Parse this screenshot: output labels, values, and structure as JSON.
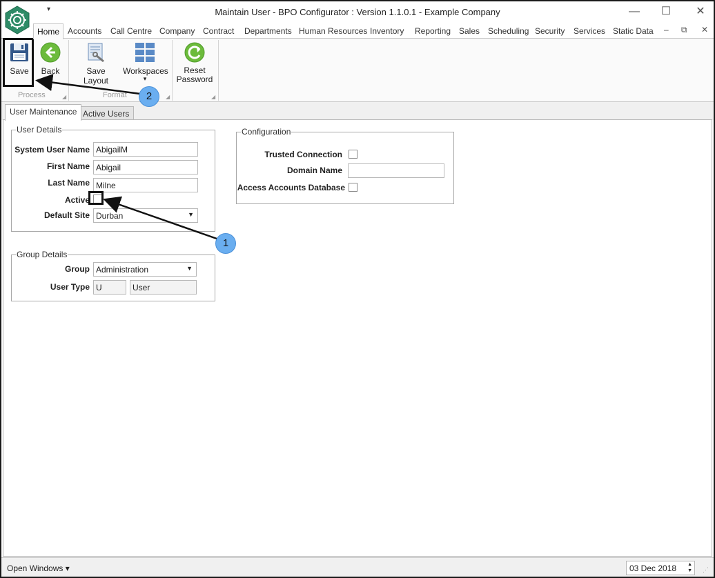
{
  "window": {
    "title": "Maintain User - BPO Configurator : Version 1.1.0.1 - Example Company",
    "controls": {
      "minimize": "—",
      "maximize": "☐",
      "close": "✕"
    },
    "mdi_controls": {
      "minimize": "–",
      "restore": "⧉",
      "close": "✕"
    },
    "qat": "▾"
  },
  "ribbon_tabs": [
    "Home",
    "Accounts",
    "Call Centre",
    "Company",
    "Contract",
    "Departments",
    "Human Resources",
    "Inventory",
    "Reporting",
    "Sales",
    "Scheduling",
    "Security",
    "Services",
    "Static Data"
  ],
  "ribbon": {
    "save": "Save",
    "back": "Back",
    "save_layout": "Save Layout",
    "workspaces": "Workspaces",
    "reset_password": "Reset Password",
    "group_process": "Process",
    "group_format": "Format",
    "dropdown_arrow": "▾"
  },
  "content_tabs": {
    "user_maintenance": "User Maintenance",
    "active_users": "Active Users"
  },
  "user_details": {
    "title": "User Details",
    "system_user_name_label": "System User Name",
    "system_user_name": "AbigailM",
    "first_name_label": "First Name",
    "first_name": "Abigail",
    "last_name_label": "Last Name",
    "last_name": "Milne",
    "active_label": "Active",
    "active": false,
    "default_site_label": "Default Site",
    "default_site": "Durban"
  },
  "group_details": {
    "title": "Group Details",
    "group_label": "Group",
    "group": "Administration",
    "user_type_label": "User Type",
    "user_type_code": "U",
    "user_type_name": "User"
  },
  "configuration": {
    "title": "Configuration",
    "trusted_connection_label": "Trusted Connection",
    "trusted_connection": false,
    "domain_name_label": "Domain Name",
    "domain_name": "",
    "access_accounts_db_label": "Access Accounts Database",
    "access_accounts_db": false
  },
  "callouts": {
    "one": "1",
    "two": "2"
  },
  "status_bar": {
    "open_windows": "Open Windows ▾",
    "date": "03 Dec 2018",
    "spin_up": "▲",
    "spin_down": "▼"
  },
  "colors": {
    "logo_green": "#2e8b67",
    "badge_blue": "#6aaef0",
    "back_green": "#6cbb3c",
    "save_blue": "#34588a"
  }
}
